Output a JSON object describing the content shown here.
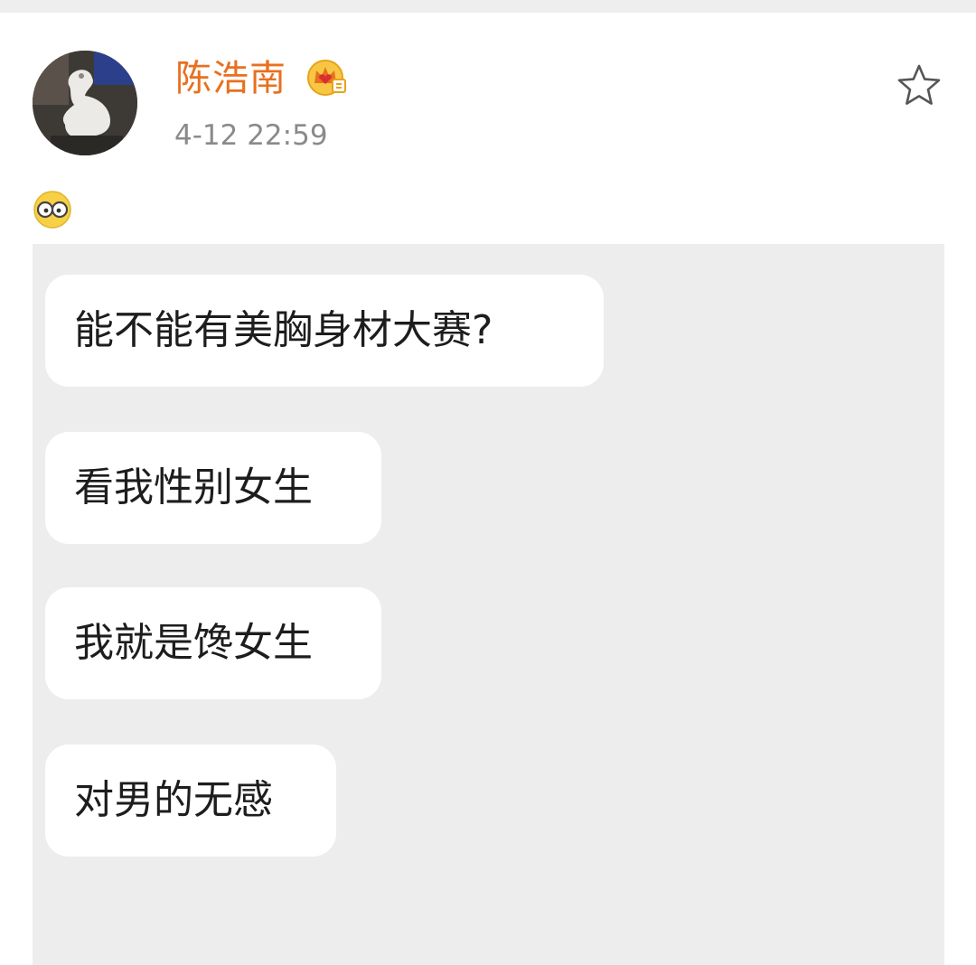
{
  "post": {
    "author": "陈浩南",
    "timestamp": "4-12 22:59",
    "vip_badge_icon": "crown-badge-icon",
    "favorite_icon": "star-outline-icon",
    "body_emoji_icon": "glasses-emoji-icon"
  },
  "chat_screenshot": {
    "messages": [
      "能不能有美胸身材大赛?",
      "看我性别女生",
      "我就是馋女生",
      "对男的无感"
    ]
  },
  "colors": {
    "author_name": "#e8701f",
    "timestamp": "#8a8a8a",
    "screenshot_bg": "#ededed",
    "bubble_bg": "#ffffff"
  }
}
